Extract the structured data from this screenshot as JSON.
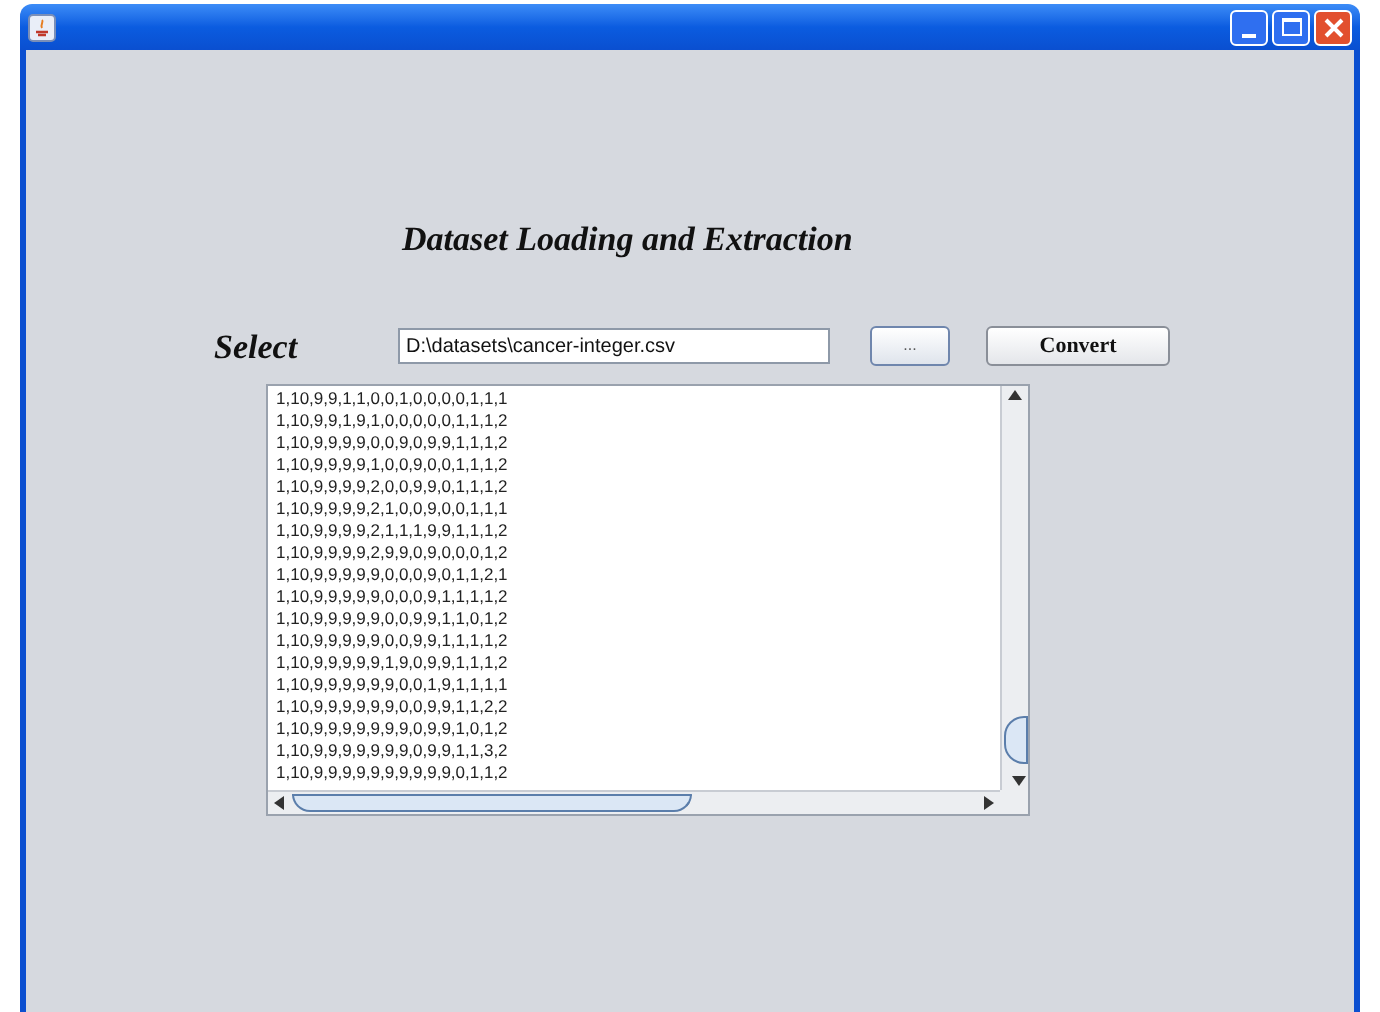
{
  "heading": "Dataset Loading and Extraction",
  "select_label": "Select",
  "path_field": {
    "value": "D:\\datasets\\cancer-integer.csv"
  },
  "browse_button": "...",
  "convert_button": "Convert",
  "text_area": {
    "lines": [
      "1,10,9,9,1,1,0,0,1,0,0,0,0,1,1,1",
      "1,10,9,9,1,9,1,0,0,0,0,0,1,1,1,2",
      "1,10,9,9,9,9,0,0,9,0,9,9,1,1,1,2",
      "1,10,9,9,9,9,1,0,0,9,0,0,1,1,1,2",
      "1,10,9,9,9,9,2,0,0,9,9,0,1,1,1,2",
      "1,10,9,9,9,9,2,1,0,0,9,0,0,1,1,1",
      "1,10,9,9,9,9,2,1,1,1,9,9,1,1,1,2",
      "1,10,9,9,9,9,2,9,9,0,9,0,0,0,1,2",
      "1,10,9,9,9,9,9,0,0,0,9,0,1,1,2,1",
      "1,10,9,9,9,9,9,0,0,0,9,1,1,1,1,2",
      "1,10,9,9,9,9,9,0,0,9,9,1,1,0,1,2",
      "1,10,9,9,9,9,9,0,0,9,9,1,1,1,1,2",
      "1,10,9,9,9,9,9,1,9,0,9,9,1,1,1,2",
      "1,10,9,9,9,9,9,9,0,0,1,9,1,1,1,1",
      "1,10,9,9,9,9,9,9,0,0,9,9,1,1,2,2",
      "1,10,9,9,9,9,9,9,9,0,9,9,1,0,1,2",
      "1,10,9,9,9,9,9,9,9,0,9,9,1,1,3,2",
      "1,10,9,9,9,9,9,9,9,9,9,9,0,1,1,2"
    ]
  }
}
